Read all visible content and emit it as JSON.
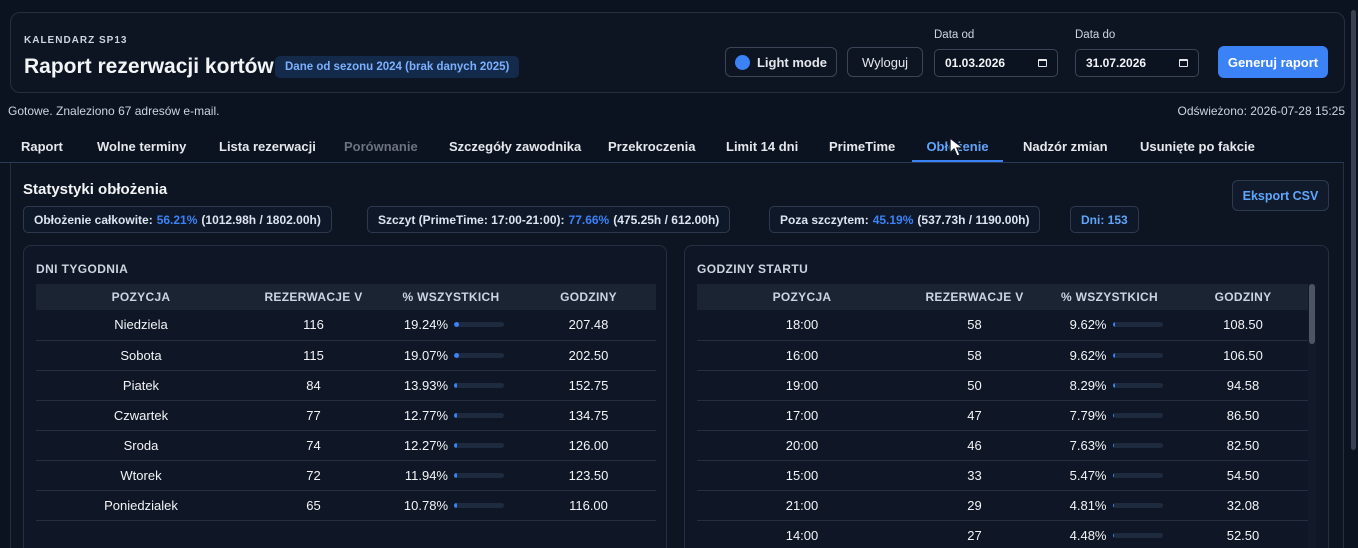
{
  "header": {
    "app_label": "KALENDARZ SP13",
    "title": "Raport rezerwacji kortów",
    "season_badge": "Dane od sezonu 2024 (brak danych 2025)",
    "light_mode_label": "Light mode",
    "logout_label": "Wyloguj",
    "date_from_label": "Data od",
    "date_from_value": "01.03.2026",
    "date_to_label": "Data do",
    "date_to_value": "31.07.2026",
    "generate_label": "Generuj raport"
  },
  "status": {
    "left": "Gotowe. Znaleziono 67 adresów e-mail.",
    "right": "Odświeżono: 2026-07-28 15:25"
  },
  "tabs": [
    {
      "label": "Raport",
      "state": "normal"
    },
    {
      "label": "Wolne terminy",
      "state": "normal"
    },
    {
      "label": "Lista rezerwacji",
      "state": "normal"
    },
    {
      "label": "Porównanie",
      "state": "disabled"
    },
    {
      "label": "Szczegóły zawodnika",
      "state": "normal"
    },
    {
      "label": "Przekroczenia",
      "state": "normal"
    },
    {
      "label": "Limit 14 dni",
      "state": "normal"
    },
    {
      "label": "PrimeTime",
      "state": "normal"
    },
    {
      "label": "Obłożenie",
      "state": "active"
    },
    {
      "label": "Nadzór zmian",
      "state": "normal"
    },
    {
      "label": "Usunięte po fakcie",
      "state": "normal"
    }
  ],
  "stats": {
    "title": "Statystyki obłożenia",
    "export_label": "Eksport CSV",
    "total_label": "Obłożenie całkowite:",
    "total_pct": "56.21%",
    "total_detail": "(1012.98h / 1802.00h)",
    "peak_label": "Szczyt (PrimeTime: 17:00-21:00):",
    "peak_pct": "77.66%",
    "peak_detail": "(475.25h / 612.00h)",
    "offpeak_label": "Poza szczytem:",
    "offpeak_pct": "45.19%",
    "offpeak_detail": "(537.73h / 1190.00h)",
    "days_label": "Dni: 153"
  },
  "weekdays": {
    "title": "DNI TYGODNIA",
    "columns": [
      "POZYCJA",
      "REZERWACJE V",
      "% WSZYSTKICH",
      "GODZINY"
    ],
    "rows": [
      {
        "pos": "Niedziela",
        "count": "116",
        "pct": "19.24%",
        "frac": 0.1924,
        "hours": "207.48"
      },
      {
        "pos": "Sobota",
        "count": "115",
        "pct": "19.07%",
        "frac": 0.1907,
        "hours": "202.50"
      },
      {
        "pos": "Piatek",
        "count": "84",
        "pct": "13.93%",
        "frac": 0.1393,
        "hours": "152.75"
      },
      {
        "pos": "Czwartek",
        "count": "77",
        "pct": "12.77%",
        "frac": 0.1277,
        "hours": "134.75"
      },
      {
        "pos": "Sroda",
        "count": "74",
        "pct": "12.27%",
        "frac": 0.1227,
        "hours": "126.00"
      },
      {
        "pos": "Wtorek",
        "count": "72",
        "pct": "11.94%",
        "frac": 0.1194,
        "hours": "123.50"
      },
      {
        "pos": "Poniedzialek",
        "count": "65",
        "pct": "10.78%",
        "frac": 0.1078,
        "hours": "116.00"
      }
    ]
  },
  "starthours": {
    "title": "GODZINY STARTU",
    "columns": [
      "POZYCJA",
      "REZERWACJE V",
      "% WSZYSTKICH",
      "GODZINY"
    ],
    "rows": [
      {
        "pos": "18:00",
        "count": "58",
        "pct": "9.62%",
        "frac": 0.0962,
        "hours": "108.50"
      },
      {
        "pos": "16:00",
        "count": "58",
        "pct": "9.62%",
        "frac": 0.0962,
        "hours": "106.50"
      },
      {
        "pos": "19:00",
        "count": "50",
        "pct": "8.29%",
        "frac": 0.0829,
        "hours": "94.58"
      },
      {
        "pos": "17:00",
        "count": "47",
        "pct": "7.79%",
        "frac": 0.0779,
        "hours": "86.50"
      },
      {
        "pos": "20:00",
        "count": "46",
        "pct": "7.63%",
        "frac": 0.0763,
        "hours": "82.50"
      },
      {
        "pos": "15:00",
        "count": "33",
        "pct": "5.47%",
        "frac": 0.0547,
        "hours": "54.50"
      },
      {
        "pos": "21:00",
        "count": "29",
        "pct": "4.81%",
        "frac": 0.0481,
        "hours": "32.08"
      },
      {
        "pos": "14:00",
        "count": "27",
        "pct": "4.48%",
        "frac": 0.0448,
        "hours": "52.50"
      }
    ]
  },
  "colors": {
    "accent": "#3b82f6",
    "background": "#0b1220"
  }
}
